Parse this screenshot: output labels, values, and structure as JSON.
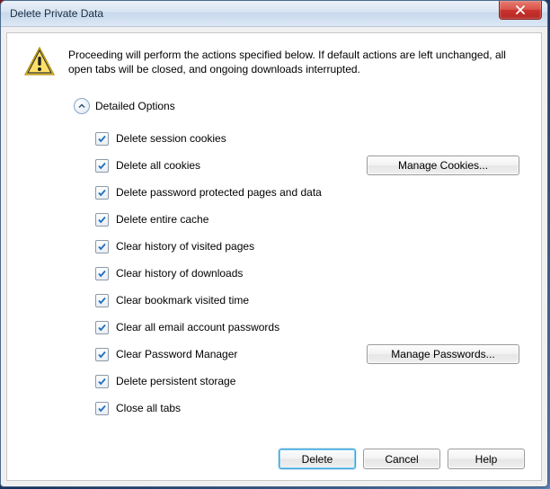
{
  "window": {
    "title": "Delete Private Data"
  },
  "description": "Proceeding will perform the actions specified below. If default actions are left unchanged, all open tabs will be closed, and ongoing downloads interrupted.",
  "detailed": {
    "title": "Detailed Options",
    "expanded": true,
    "options": [
      {
        "label": "Delete session cookies"
      },
      {
        "label": "Delete all cookies",
        "button": "Manage Cookies..."
      },
      {
        "label": "Delete password protected pages and data"
      },
      {
        "label": "Delete entire cache"
      },
      {
        "label": "Clear history of visited pages"
      },
      {
        "label": "Clear history of downloads"
      },
      {
        "label": "Clear bookmark visited time"
      },
      {
        "label": "Clear all email account passwords"
      },
      {
        "label": "Clear Password Manager",
        "button": "Manage Passwords..."
      },
      {
        "label": "Delete persistent storage"
      },
      {
        "label": "Close all tabs"
      }
    ]
  },
  "footer": {
    "delete": "Delete",
    "cancel": "Cancel",
    "help": "Help"
  }
}
